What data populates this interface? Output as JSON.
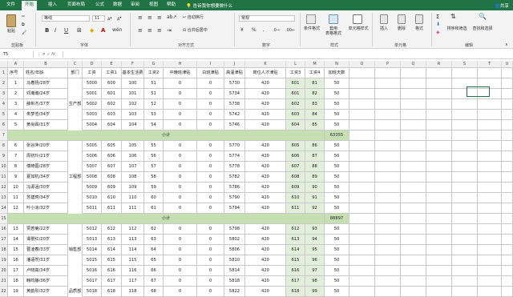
{
  "menu": {
    "tabs": [
      "文件",
      "开始",
      "插入",
      "页面布局",
      "公式",
      "数据",
      "审阅",
      "视图",
      "帮助"
    ],
    "tell_me": "告诉我你想要做什么",
    "share": "共享"
  },
  "ribbon": {
    "groups": [
      "剪贴板",
      "字体",
      "对齐方式",
      "数字",
      "样式",
      "单元格",
      "编辑"
    ],
    "font_name": "等线",
    "font_size": "11",
    "number_format": "常规",
    "wrap_text": "自动换行",
    "merge_center": "合并后居中",
    "buttons": {
      "paste": "粘贴",
      "cond_format": "条件格式",
      "table_format": "套用\n表格格式",
      "cell_style": "单元格样式",
      "insert": "插入",
      "delete": "删除",
      "format": "格式",
      "sort_filter": "排序和筛选",
      "find_select": "查找和选择"
    }
  },
  "formula_bar": {
    "name_box": "T5",
    "fx": "fx",
    "value": ""
  },
  "columns": [
    "A",
    "B",
    "C",
    "D",
    "E",
    "F",
    "G",
    "H",
    "I",
    "J",
    "K",
    "L",
    "M",
    "N",
    "O",
    "P",
    "Q",
    "R",
    "S",
    "T",
    "U"
  ],
  "header_row": [
    "序号",
    "姓名/年龄",
    "部门",
    "工资",
    "工资1",
    "基本生活费",
    "工资2",
    "中晚班津贴",
    "白班津贴",
    "高温津贴",
    "岗位人才津贴",
    "工资3",
    "工资4",
    "加班天数"
  ],
  "rows": [
    {
      "r": "2",
      "cells": [
        "1",
        "马春扬/28岁",
        "",
        "5000",
        "600",
        "100",
        "51",
        "0",
        "0",
        "5730",
        "420",
        "601",
        "81",
        "50"
      ]
    },
    {
      "r": "3",
      "cells": [
        "2",
        "邓瀚瀚/24岁",
        "",
        "5001",
        "601",
        "101",
        "51",
        "0",
        "0",
        "5734",
        "420",
        "601",
        "82",
        "50"
      ]
    },
    {
      "r": "4",
      "cells": [
        "3",
        "薛彬杰/37岁",
        "生产部",
        "5002",
        "602",
        "102",
        "52",
        "0",
        "0",
        "5738",
        "420",
        "602",
        "83",
        "50"
      ]
    },
    {
      "r": "5",
      "cells": [
        "4",
        "朱梦览/34岁",
        "",
        "5003",
        "603",
        "103",
        "53",
        "0",
        "0",
        "5742",
        "420",
        "603",
        "84",
        "50"
      ]
    },
    {
      "r": "6",
      "cells": [
        "5",
        "黄尚霖/31岁",
        "",
        "5004",
        "604",
        "104",
        "54",
        "0",
        "0",
        "5746",
        "420",
        "604",
        "85",
        "50"
      ]
    },
    {
      "r": "7",
      "subtotal": true,
      "label": "小计",
      "value": "63355"
    },
    {
      "r": "8",
      "cells": [
        "6",
        "张谷萍/20岁",
        "",
        "5005",
        "605",
        "105",
        "55",
        "0",
        "0",
        "5770",
        "420",
        "605",
        "86",
        "50"
      ]
    },
    {
      "r": "9",
      "cells": [
        "7",
        "周初玲/21岁",
        "",
        "5006",
        "606",
        "106",
        "56",
        "0",
        "0",
        "5774",
        "420",
        "606",
        "87",
        "50"
      ]
    },
    {
      "r": "10",
      "cells": [
        "8",
        "傅琦蓉/28岁",
        "",
        "5007",
        "607",
        "107",
        "57",
        "0",
        "0",
        "5778",
        "420",
        "607",
        "88",
        "50"
      ]
    },
    {
      "r": "11",
      "cells": [
        "9",
        "夏如杭/34岁",
        "工程部",
        "5008",
        "608",
        "108",
        "58",
        "0",
        "0",
        "5782",
        "420",
        "608",
        "89",
        "50"
      ]
    },
    {
      "r": "12",
      "cells": [
        "10",
        "冯源涵/30岁",
        "",
        "5009",
        "609",
        "109",
        "59",
        "0",
        "0",
        "5786",
        "420",
        "609",
        "90",
        "50"
      ]
    },
    {
      "r": "13",
      "cells": [
        "11",
        "苏建珂/34岁",
        "",
        "5010",
        "610",
        "110",
        "60",
        "0",
        "0",
        "5790",
        "420",
        "610",
        "91",
        "50"
      ]
    },
    {
      "r": "14",
      "cells": [
        "12",
        "叶小凉/32岁",
        "",
        "5011",
        "611",
        "111",
        "61",
        "0",
        "0",
        "5794",
        "420",
        "611",
        "92",
        "50"
      ]
    },
    {
      "r": "15",
      "subtotal": true,
      "label": "小计",
      "value": "88897"
    },
    {
      "r": "16",
      "cells": [
        "13",
        "贾若菊/22岁",
        "",
        "5012",
        "612",
        "112",
        "62",
        "0",
        "0",
        "5798",
        "420",
        "612",
        "93",
        "50"
      ]
    },
    {
      "r": "17",
      "cells": [
        "14",
        "谭景红/20岁",
        "",
        "5013",
        "613",
        "113",
        "63",
        "0",
        "0",
        "5802",
        "420",
        "613",
        "94",
        "50"
      ]
    },
    {
      "r": "18",
      "cells": [
        "15",
        "曹凌春/33岁",
        "销售部",
        "5014",
        "614",
        "114",
        "64",
        "0",
        "0",
        "5806",
        "420",
        "614",
        "95",
        "50"
      ]
    },
    {
      "r": "19",
      "cells": [
        "16",
        "潘语然/31岁",
        "",
        "5015",
        "615",
        "115",
        "65",
        "0",
        "0",
        "5810",
        "420",
        "615",
        "96",
        "50"
      ]
    },
    {
      "r": "20",
      "cells": [
        "17",
        "卢晓高/34岁",
        "",
        "5016",
        "616",
        "116",
        "66",
        "0",
        "0",
        "5814",
        "420",
        "616",
        "97",
        "50"
      ]
    },
    {
      "r": "21",
      "cells": [
        "18",
        "韩鸣静/36岁",
        "",
        "5017",
        "617",
        "117",
        "67",
        "0",
        "0",
        "5818",
        "420",
        "617",
        "98",
        "50"
      ]
    },
    {
      "r": "22",
      "cells": [
        "19",
        "黄韵彤/32岁",
        "品质部",
        "5018",
        "618",
        "118",
        "68",
        "0",
        "0",
        "5822",
        "420",
        "618",
        "99",
        "50"
      ]
    }
  ],
  "colors": {
    "accent": "#217346",
    "subtotal_fill": "#c6e0b4",
    "header_fill": "#f0f0f0"
  }
}
